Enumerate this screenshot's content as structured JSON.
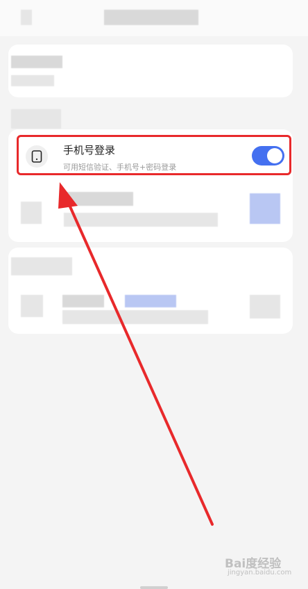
{
  "phone_login": {
    "title": "手机号登录",
    "subtitle": "可用短信验证、手机号+密码登录",
    "toggle_on": true,
    "toggle_color": "#4470f0"
  },
  "annotation": {
    "highlight_color": "#e8292b",
    "arrow_color": "#e8292b"
  },
  "watermark": {
    "brand": "Bai度经验",
    "url": "jingyan.baidu.com"
  },
  "icons": {
    "row_icon": "phone-icon",
    "watermark_icon": "paw-icon"
  }
}
